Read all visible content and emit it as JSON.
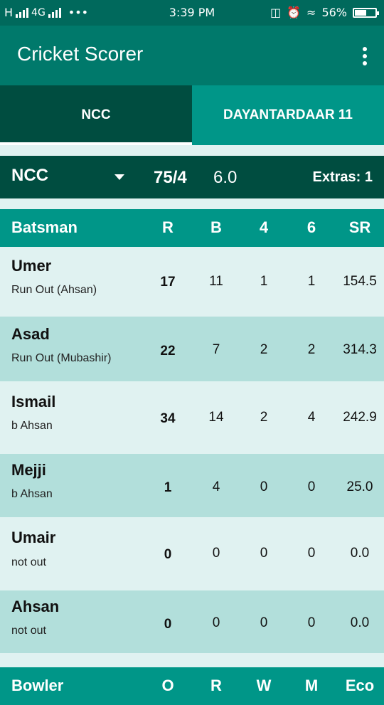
{
  "status": {
    "network": "H",
    "network2": "4G",
    "dots": "•••",
    "time": "3:39 PM",
    "battery": "56%",
    "battery_level": 0.56
  },
  "appbar": {
    "title": "Cricket Scorer"
  },
  "tabs": [
    {
      "label": "NCC"
    },
    {
      "label": "DAYANTARDAAR 11"
    }
  ],
  "scorebar": {
    "team": "NCC",
    "score": "75/4",
    "overs": "6.0",
    "extras": "Extras: 1"
  },
  "batting": {
    "headers": {
      "batsman": "Batsman",
      "r": "R",
      "b": "B",
      "fours": "4",
      "sixes": "6",
      "sr": "SR"
    },
    "rows": [
      {
        "name": "Umer",
        "how": "Run Out (Ahsan)",
        "r": "17",
        "b": "11",
        "fours": "1",
        "sixes": "1",
        "sr": "154.5"
      },
      {
        "name": "Asad",
        "how": "Run Out (Mubashir)",
        "r": "22",
        "b": "7",
        "fours": "2",
        "sixes": "2",
        "sr": "314.3"
      },
      {
        "name": "Ismail",
        "how": "b Ahsan",
        "r": "34",
        "b": "14",
        "fours": "2",
        "sixes": "4",
        "sr": "242.9"
      },
      {
        "name": "Mejji",
        "how": "b Ahsan",
        "r": "1",
        "b": "4",
        "fours": "0",
        "sixes": "0",
        "sr": "25.0"
      },
      {
        "name": "Umair",
        "how": "not out",
        "r": "0",
        "b": "0",
        "fours": "0",
        "sixes": "0",
        "sr": "0.0"
      },
      {
        "name": "Ahsan",
        "how": "not out",
        "r": "0",
        "b": "0",
        "fours": "0",
        "sixes": "0",
        "sr": "0.0"
      }
    ]
  },
  "bowling": {
    "headers": {
      "bowler": "Bowler",
      "o": "O",
      "r": "R",
      "w": "W",
      "m": "M",
      "eco": "Eco"
    }
  }
}
